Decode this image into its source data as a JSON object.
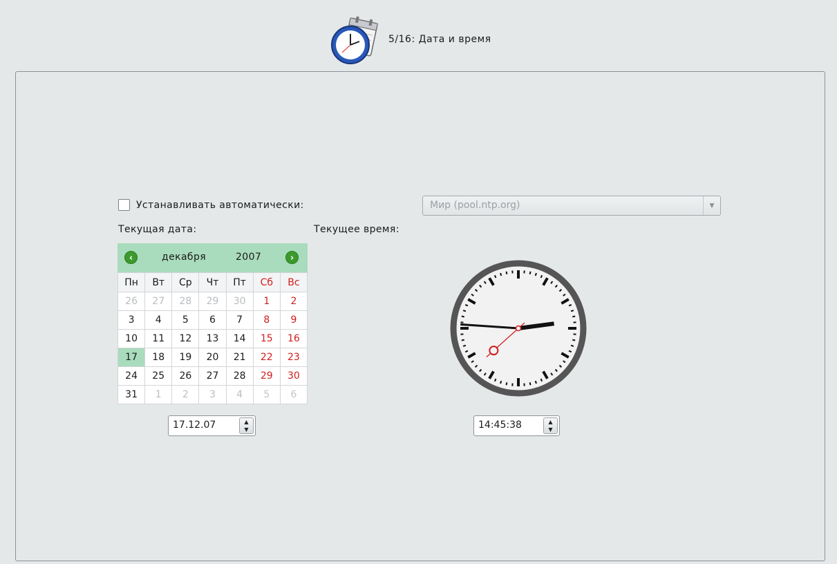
{
  "header": {
    "step_title": "5/16: Дата и время",
    "icon": "clock-calendar-icon"
  },
  "auto": {
    "label": "Устанавливать автоматически:",
    "checked": false
  },
  "ntp_server": {
    "value": "Мир (pool.ntp.org)",
    "enabled": false
  },
  "labels": {
    "current_date": "Текущая дата:",
    "current_time": "Текущее время:"
  },
  "calendar": {
    "month": "декабря",
    "year": "2007",
    "weekdays": [
      "Пн",
      "Вт",
      "Ср",
      "Чт",
      "Пт",
      "Сб",
      "Вс"
    ],
    "weeks": [
      [
        "26",
        "27",
        "28",
        "29",
        "30",
        "1",
        "2"
      ],
      [
        "3",
        "4",
        "5",
        "6",
        "7",
        "8",
        "9"
      ],
      [
        "10",
        "11",
        "12",
        "13",
        "14",
        "15",
        "16"
      ],
      [
        "17",
        "18",
        "19",
        "20",
        "21",
        "22",
        "23"
      ],
      [
        "24",
        "25",
        "26",
        "27",
        "28",
        "29",
        "30"
      ],
      [
        "31",
        "1",
        "2",
        "3",
        "4",
        "5",
        "6"
      ]
    ],
    "selected_day": "17",
    "colors": {
      "header_bg": "#a9dcbc",
      "weekend": "#d01d1d",
      "selected_bg": "#a9dcbc"
    }
  },
  "date_field": {
    "value": "17.12.07"
  },
  "time_field": {
    "value": "14:45:38"
  },
  "clock": {
    "hours": 14,
    "minutes": 45,
    "seconds": 38
  }
}
